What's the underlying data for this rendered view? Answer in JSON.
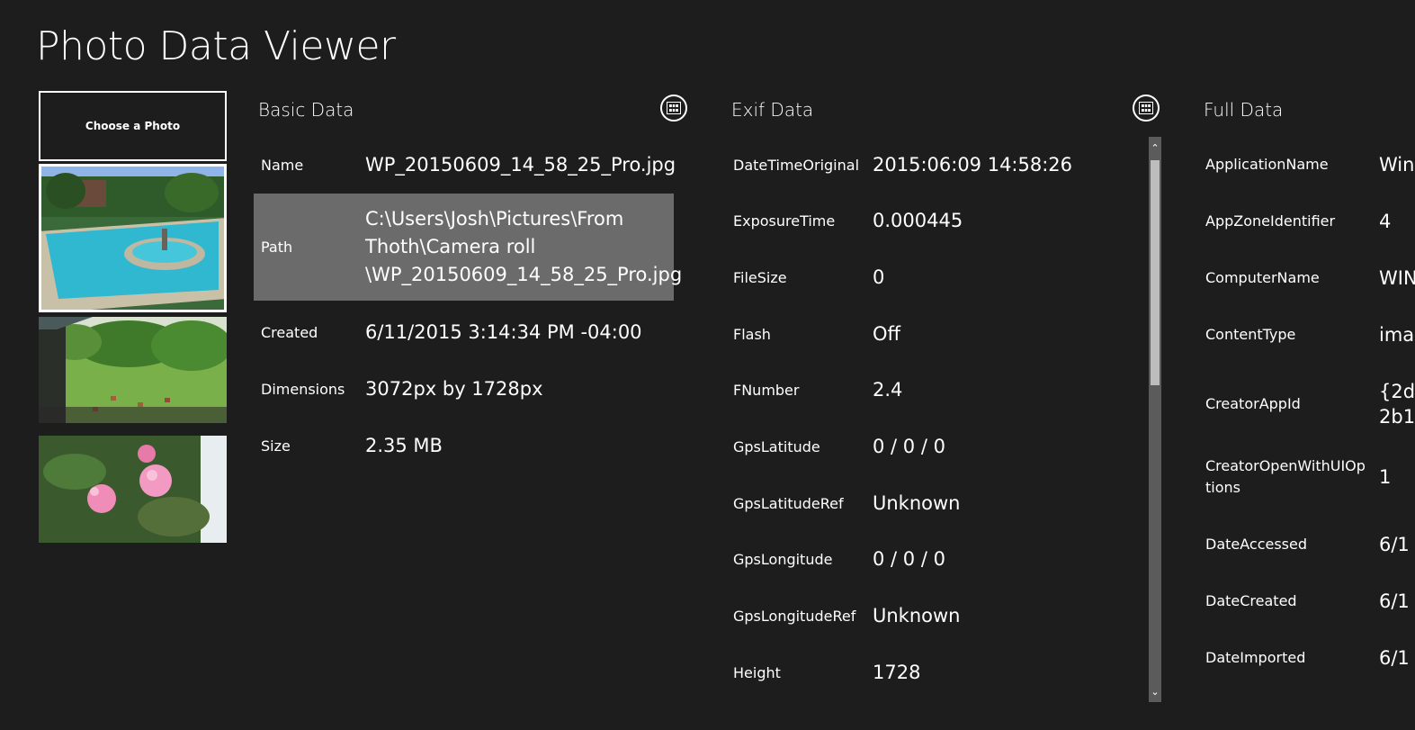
{
  "app": {
    "title": "Photo Data Viewer"
  },
  "sidebar": {
    "choose_label": "Choose a Photo"
  },
  "basic": {
    "header": "Basic Data",
    "rows": [
      {
        "key": "Name",
        "value": "WP_20150609_14_58_25_Pro.jpg"
      },
      {
        "key": "Path",
        "value": "C:\\Users\\Josh\\Pictures\\From Thoth\\Camera roll \\WP_20150609_14_58_25_Pro.jpg"
      },
      {
        "key": "Created",
        "value": "6/11/2015 3:14:34 PM -04:00"
      },
      {
        "key": "Dimensions",
        "value": "3072px by 1728px"
      },
      {
        "key": "Size",
        "value": "2.35 MB"
      }
    ]
  },
  "exif": {
    "header": "Exif Data",
    "rows": [
      {
        "key": "DateTimeOriginal",
        "value": "2015:06:09 14:58:26"
      },
      {
        "key": "ExposureTime",
        "value": "0.000445"
      },
      {
        "key": "FileSize",
        "value": "0"
      },
      {
        "key": "Flash",
        "value": "Off"
      },
      {
        "key": "FNumber",
        "value": "2.4"
      },
      {
        "key": "GpsLatitude",
        "value": "0 / 0 / 0"
      },
      {
        "key": "GpsLatitudeRef",
        "value": "Unknown"
      },
      {
        "key": "GpsLongitude",
        "value": "0 / 0 / 0"
      },
      {
        "key": "GpsLongitudeRef",
        "value": "Unknown"
      },
      {
        "key": "Height",
        "value": "1728"
      }
    ]
  },
  "full": {
    "header": "Full Data",
    "rows": [
      {
        "key": "ApplicationName",
        "value": "Win"
      },
      {
        "key": "AppZoneIdentifier",
        "value": "4"
      },
      {
        "key": "ComputerName",
        "value": "WIN"
      },
      {
        "key": "ContentType",
        "value": "ima"
      },
      {
        "key": "CreatorAppId",
        "value": "{2d\n2b1"
      },
      {
        "key": "CreatorOpenWithUIOptions",
        "value": "1"
      },
      {
        "key": "DateAccessed",
        "value": "6/1"
      },
      {
        "key": "DateCreated",
        "value": "6/1"
      },
      {
        "key": "DateImported",
        "value": "6/1"
      }
    ]
  },
  "colors": {
    "background": "#1d1d1d",
    "highlight": "#6b6b6b",
    "text": "#ffffff"
  },
  "icons": {
    "view_toggle": "grid-view-icon"
  }
}
